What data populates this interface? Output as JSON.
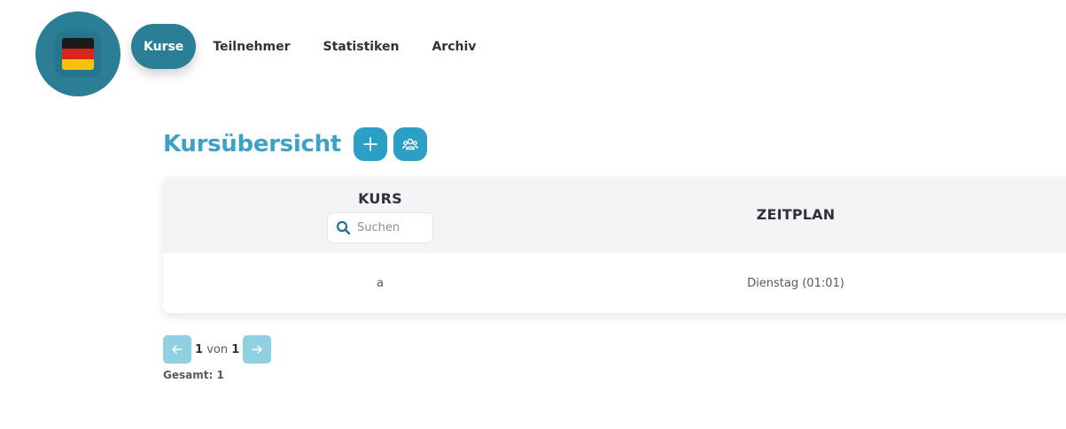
{
  "logo": {
    "icon": "german-flag-icon",
    "colors": [
      "#1a1a1a",
      "#d9261c",
      "#f4c20d"
    ]
  },
  "nav": {
    "items": [
      {
        "label": "Kurse",
        "active": true
      },
      {
        "label": "Teilnehmer",
        "active": false
      },
      {
        "label": "Statistiken",
        "active": false
      },
      {
        "label": "Archiv",
        "active": false
      }
    ]
  },
  "main": {
    "title": "Kursübersicht",
    "add_icon": "plus-icon",
    "group_icon": "users-group-icon"
  },
  "table": {
    "columns": {
      "kurs": "KURS",
      "zeitplan": "ZEITPLAN"
    },
    "search": {
      "placeholder": "Suchen",
      "value": "",
      "icon": "search-icon"
    },
    "rows": [
      {
        "kurs": "a",
        "zeitplan": "Dienstag (01:01)"
      }
    ]
  },
  "pagination": {
    "current": "1",
    "of_label": "von",
    "total_pages": "1",
    "total_text": "Gesamt: 1"
  },
  "colors": {
    "primary_dark": "#2a7f96",
    "primary": "#2b9fc6",
    "title": "#3ea2c8",
    "pager_button": "#8fd0e3"
  }
}
